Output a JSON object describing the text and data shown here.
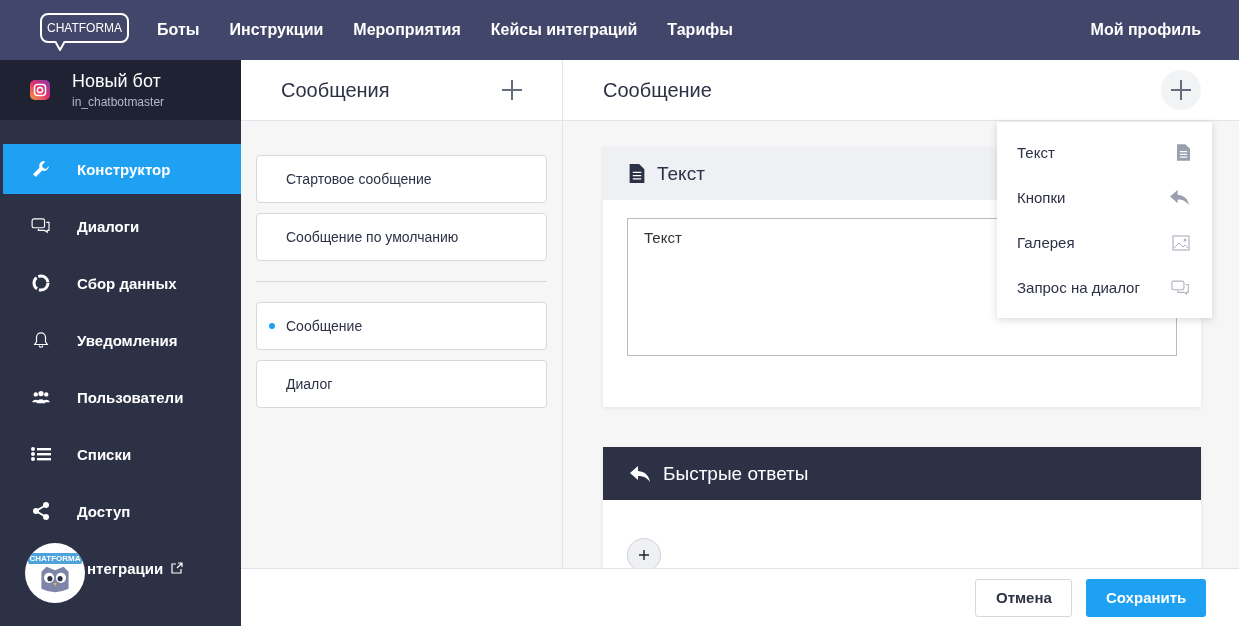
{
  "topbar": {
    "logo": "CHATFORMA",
    "links": [
      "Боты",
      "Инструкции",
      "Мероприятия",
      "Кейсы интеграций",
      "Тарифы"
    ],
    "profile": "Мой профиль"
  },
  "bot": {
    "name": "Новый бот",
    "handle": "in_chatbotmaster"
  },
  "sidebar": {
    "items": [
      {
        "label": "Конструктор",
        "selected": true
      },
      {
        "label": "Диалоги",
        "selected": false
      },
      {
        "label": "Сбор данных",
        "selected": false
      },
      {
        "label": "Уведомления",
        "selected": false
      },
      {
        "label": "Пользователи",
        "selected": false
      },
      {
        "label": "Списки",
        "selected": false
      },
      {
        "label": "Доступ",
        "selected": false
      },
      {
        "label": "нтеграции",
        "selected": false
      }
    ]
  },
  "messages": {
    "title": "Сообщения",
    "groups": [
      [
        {
          "label": "Стартовое сообщение",
          "selected": false
        },
        {
          "label": "Сообщение по умолчанию",
          "selected": false
        }
      ],
      [
        {
          "label": "Сообщение",
          "selected": true
        },
        {
          "label": "Диалог",
          "selected": false
        }
      ]
    ]
  },
  "editor": {
    "title": "Сообщение",
    "blocks": [
      {
        "kind": "text",
        "title": "Текст",
        "value": "Текст"
      },
      {
        "kind": "quick_replies",
        "title": "Быстрые ответы"
      }
    ]
  },
  "add_menu": {
    "items": [
      {
        "label": "Текст"
      },
      {
        "label": "Кнопки"
      },
      {
        "label": "Галерея"
      },
      {
        "label": "Запрос на диалог"
      }
    ]
  },
  "footer": {
    "buttons": [
      {
        "kind": "secondary",
        "label": "Отмена"
      },
      {
        "kind": "primary",
        "label": "Сохранить"
      }
    ]
  },
  "chat_widget": {
    "logo": "CHATFORMA"
  }
}
